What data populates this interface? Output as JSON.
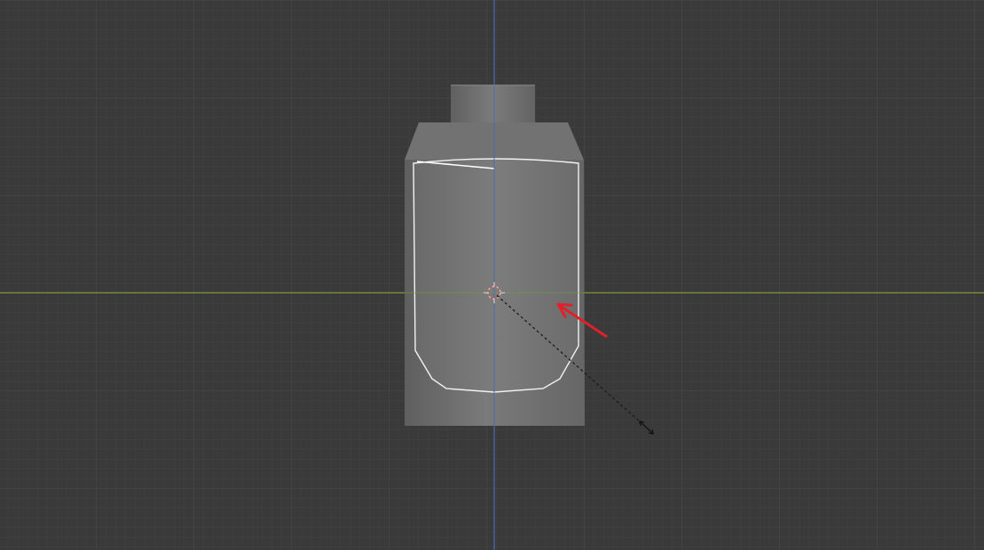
{
  "viewport": {
    "background_color": "#3a3a3a",
    "grid_minor_color": "#414141",
    "grid_major_color": "#4a4a4a",
    "axis_x_color": "#7f9a3a",
    "axis_y_color": "#4a6bb0"
  },
  "object": {
    "body_color": "#6e6e6e",
    "shoulder_color": "#767676",
    "neck_color": "#707070",
    "edge_highlight_color": "#ffffff"
  },
  "cursor": {
    "origin_icon": "3d-cursor-icon",
    "scale_handle_icon": "scale-arrows-icon"
  },
  "annotation": {
    "arrow_color": "#e0202a",
    "arrow_icon": "red-arrow-icon"
  }
}
